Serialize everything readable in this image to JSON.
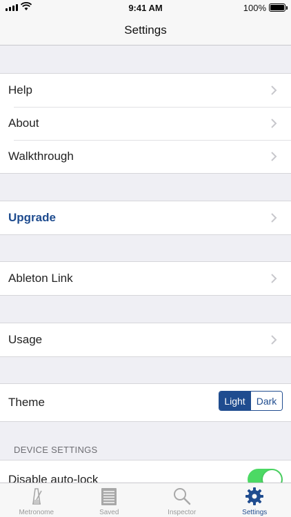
{
  "status": {
    "time": "9:41 AM",
    "battery": "100%"
  },
  "nav": {
    "title": "Settings"
  },
  "group1": {
    "help": "Help",
    "about": "About",
    "walkthrough": "Walkthrough"
  },
  "upgrade": {
    "label": "Upgrade"
  },
  "ableton": {
    "label": "Ableton Link"
  },
  "usage": {
    "label": "Usage"
  },
  "theme": {
    "label": "Theme",
    "options": [
      "Light",
      "Dark"
    ],
    "selected": "Light"
  },
  "device": {
    "header": "DEVICE SETTINGS",
    "autolock": "Disable auto-lock",
    "autolock_on": true
  },
  "tabs": [
    {
      "label": "Metronome",
      "icon": "metronome-icon",
      "active": false
    },
    {
      "label": "Saved",
      "icon": "saved-list-icon",
      "active": false
    },
    {
      "label": "Inspector",
      "icon": "search-icon",
      "active": false
    },
    {
      "label": "Settings",
      "icon": "gear-icon",
      "active": true
    }
  ],
  "colors": {
    "accent": "#1f4c8f",
    "toggle_on": "#4cd964",
    "background": "#efeff4"
  }
}
